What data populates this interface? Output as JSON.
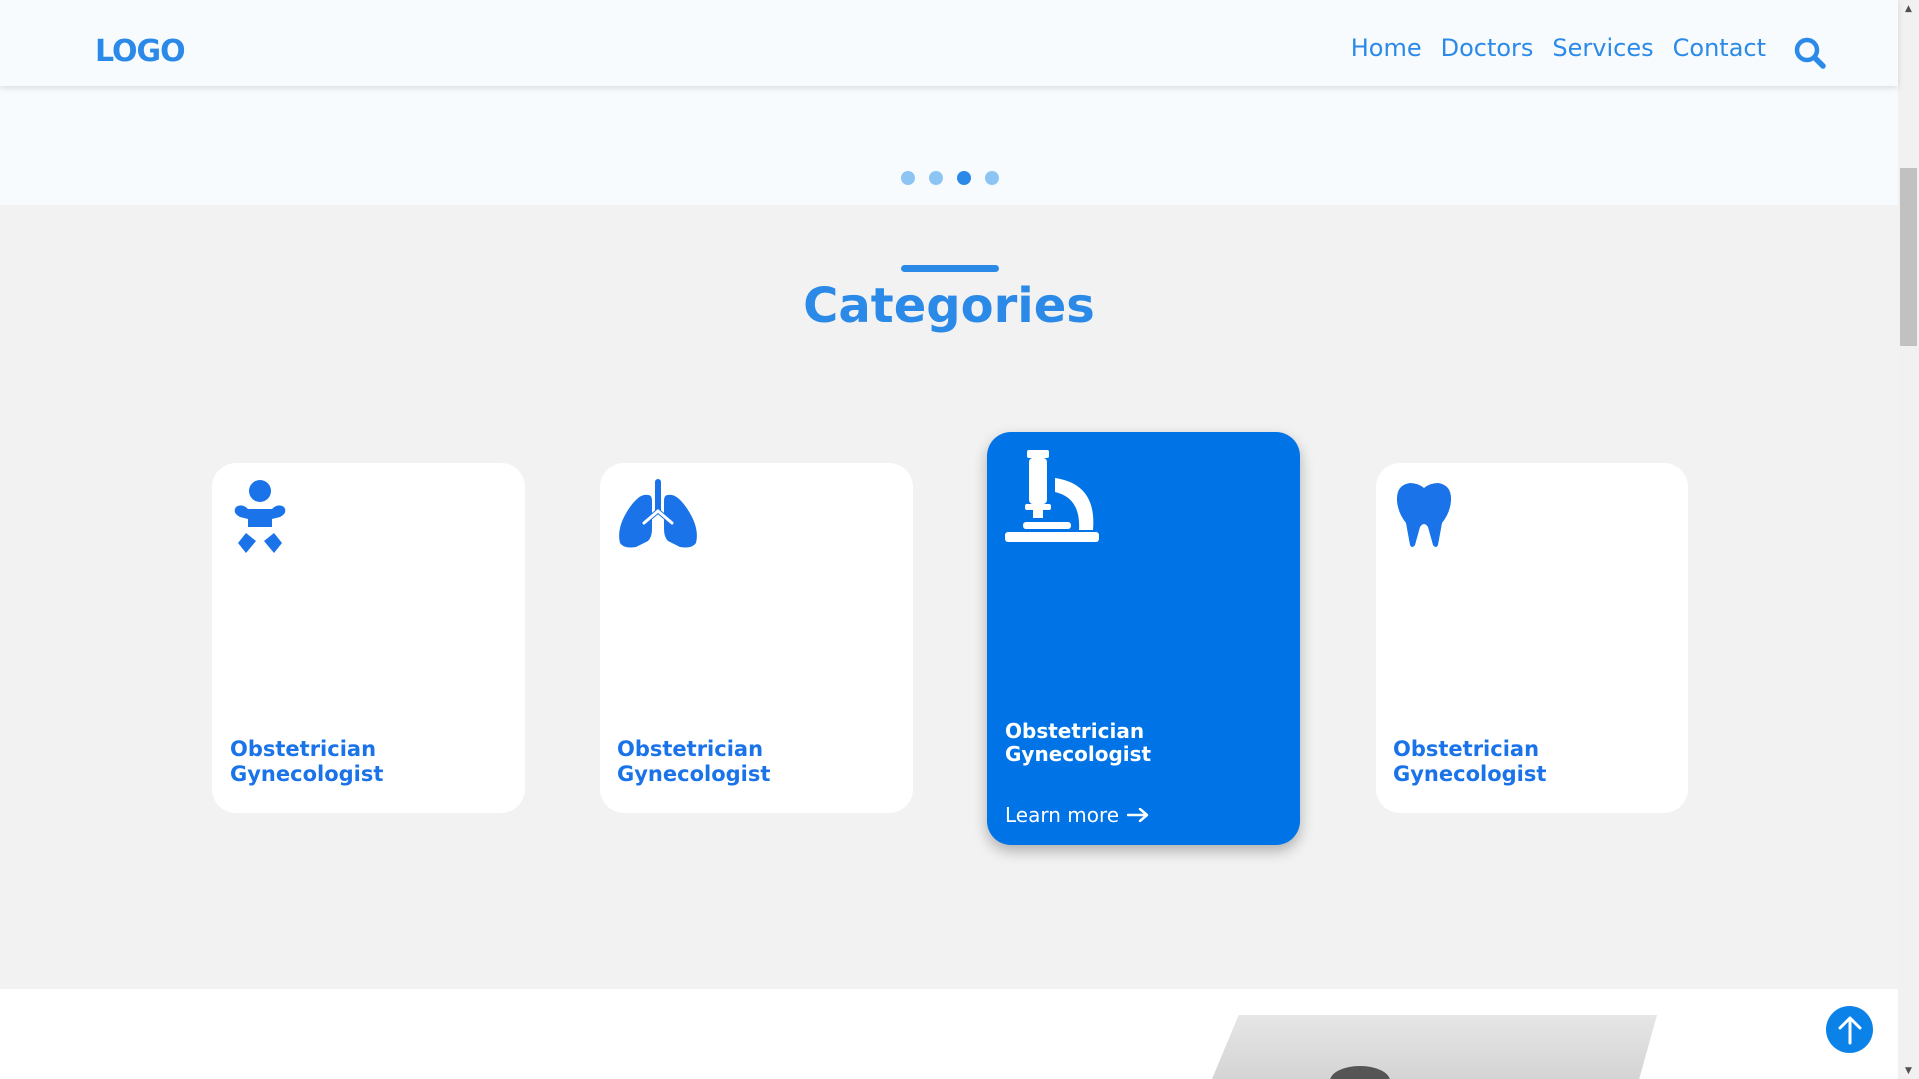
{
  "header": {
    "logo": "LOGO",
    "nav": [
      "Home",
      "Doctors",
      "Services",
      "Contact"
    ],
    "search_icon": "search-icon"
  },
  "carousel": {
    "slide_count": 4,
    "active_index": 2
  },
  "categories": {
    "title": "Categories",
    "cards": [
      {
        "icon": "baby-icon",
        "line1": "Obstetrician",
        "line2": "Gynecologist"
      },
      {
        "icon": "lungs-icon",
        "line1": "Obstetrician",
        "line2": "Gynecologist"
      },
      {
        "icon": "microscope-icon",
        "line1": "Obstetrician",
        "line2": "Gynecologist",
        "cta": "Learn more"
      },
      {
        "icon": "tooth-icon",
        "line1": "Obstetrician",
        "line2": "Gynecologist"
      }
    ]
  },
  "colors": {
    "accent": "#2b8ae8",
    "active_card": "#0073e6",
    "background": "#f2f2f2"
  }
}
